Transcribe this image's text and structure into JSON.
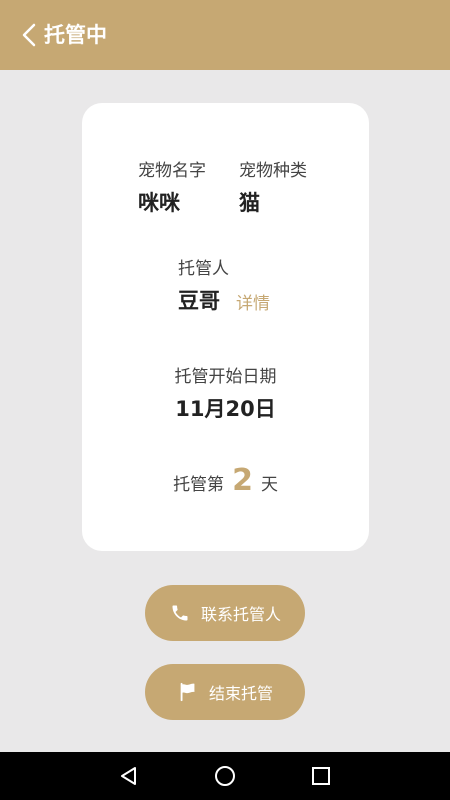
{
  "header": {
    "title": "托管中",
    "back_icon": "chevron-left-icon"
  },
  "card": {
    "pet_name_label": "宠物名字",
    "pet_name": "咪咪",
    "pet_type_label": "宠物种类",
    "pet_type": "猫",
    "caretaker_label": "托管人",
    "caretaker": "豆哥",
    "details_link": "详情",
    "start_date_label": "托管开始日期",
    "start_date": "11月20日",
    "day_prefix": "托管第",
    "day_number": "2",
    "day_suffix": "天"
  },
  "actions": {
    "contact_label": "联系托管人",
    "contact_icon": "phone-icon",
    "end_label": "结束托管",
    "end_icon": "flag-icon"
  },
  "colors": {
    "accent": "#c6a873",
    "background": "#e9e8e9",
    "card": "#ffffff",
    "navbar": "#000000"
  },
  "system_nav": {
    "back_icon": "triangle-back-icon",
    "home_icon": "circle-home-icon",
    "recents_icon": "square-recents-icon"
  }
}
